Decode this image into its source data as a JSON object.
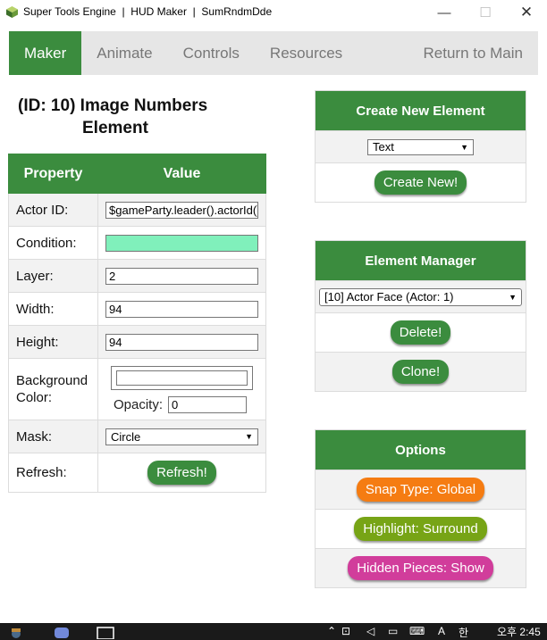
{
  "window": {
    "title": "Super Tools Engine  |  HUD Maker  |  SumRndmDde",
    "minimize_glyph": "—",
    "maximize_glyph": "☐",
    "close_glyph": "✕"
  },
  "nav": {
    "tabs": [
      "Maker",
      "Animate",
      "Controls",
      "Resources"
    ],
    "right_tab": "Return to Main"
  },
  "element": {
    "title_line1": "(ID: 10) Image Numbers",
    "title_line2": "Element"
  },
  "properties": {
    "header_property": "Property",
    "header_value": "Value",
    "actor_id_label": "Actor ID:",
    "actor_id_value": "$gameParty.leader().actorId()",
    "condition_label": "Condition:",
    "condition_value": "",
    "condition_bg": "#80f0bb",
    "layer_label": "Layer:",
    "layer_value": "2",
    "width_label": "Width:",
    "width_value": "94",
    "height_label": "Height:",
    "height_value": "94",
    "background_color_label": "Background Color:",
    "background_color_value": "",
    "opacity_label": "Opacity:",
    "opacity_value": "0",
    "mask_label": "Mask:",
    "mask_value": "Circle",
    "refresh_label": "Refresh:",
    "refresh_button": "Refresh!"
  },
  "create_panel": {
    "title": "Create New Element",
    "type_value": "Text",
    "create_button": "Create New!"
  },
  "manager_panel": {
    "title": "Element Manager",
    "selected_element": "[10] Actor Face (Actor: 1)",
    "delete_button": "Delete!",
    "clone_button": "Clone!"
  },
  "options_panel": {
    "title": "Options",
    "snap_button": "Snap Type: Global",
    "highlight_button": "Highlight: Surround",
    "hidden_button": "Hidden Pieces: Show"
  },
  "taskbar": {
    "ime_text": "A",
    "ime_mode": "한",
    "clock": "오후 2:45"
  },
  "colors": {
    "accent_green": "#3b8c3e",
    "snap_orange": "#f57c12",
    "highlight_olive": "#77a416",
    "hidden_pink": "#d13d9b"
  }
}
